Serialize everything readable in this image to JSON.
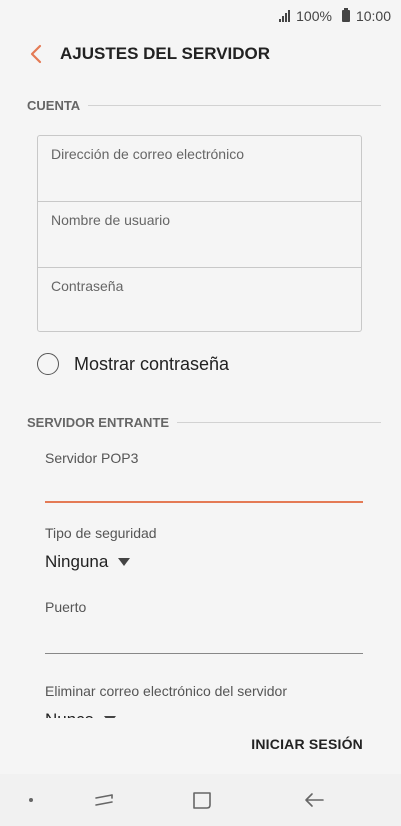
{
  "status_bar": {
    "battery": "100%",
    "time": "10:00"
  },
  "header": {
    "title": "AJUSTES DEL SERVIDOR"
  },
  "account_section": {
    "title": "CUENTA",
    "fields": {
      "email": {
        "placeholder": "Dirección de correo electrónico",
        "value": ""
      },
      "username": {
        "placeholder": "Nombre de usuario",
        "value": ""
      },
      "password": {
        "placeholder": "Contraseña",
        "value": ""
      }
    },
    "show_password_label": "Mostrar contraseña",
    "show_password_checked": false
  },
  "incoming_section": {
    "title": "SERVIDOR ENTRANTE",
    "pop3_label": "Servidor POP3",
    "pop3_value": "",
    "security_type_label": "Tipo de seguridad",
    "security_type_value": "Ninguna",
    "port_label": "Puerto",
    "port_value": "",
    "delete_email_label": "Eliminar correo electrónico del servidor",
    "delete_email_value": "Nunca"
  },
  "actions": {
    "sign_in_label": "INICIAR SESIÓN"
  },
  "colors": {
    "accent": "#e47a55",
    "background": "#f5f5f5"
  }
}
